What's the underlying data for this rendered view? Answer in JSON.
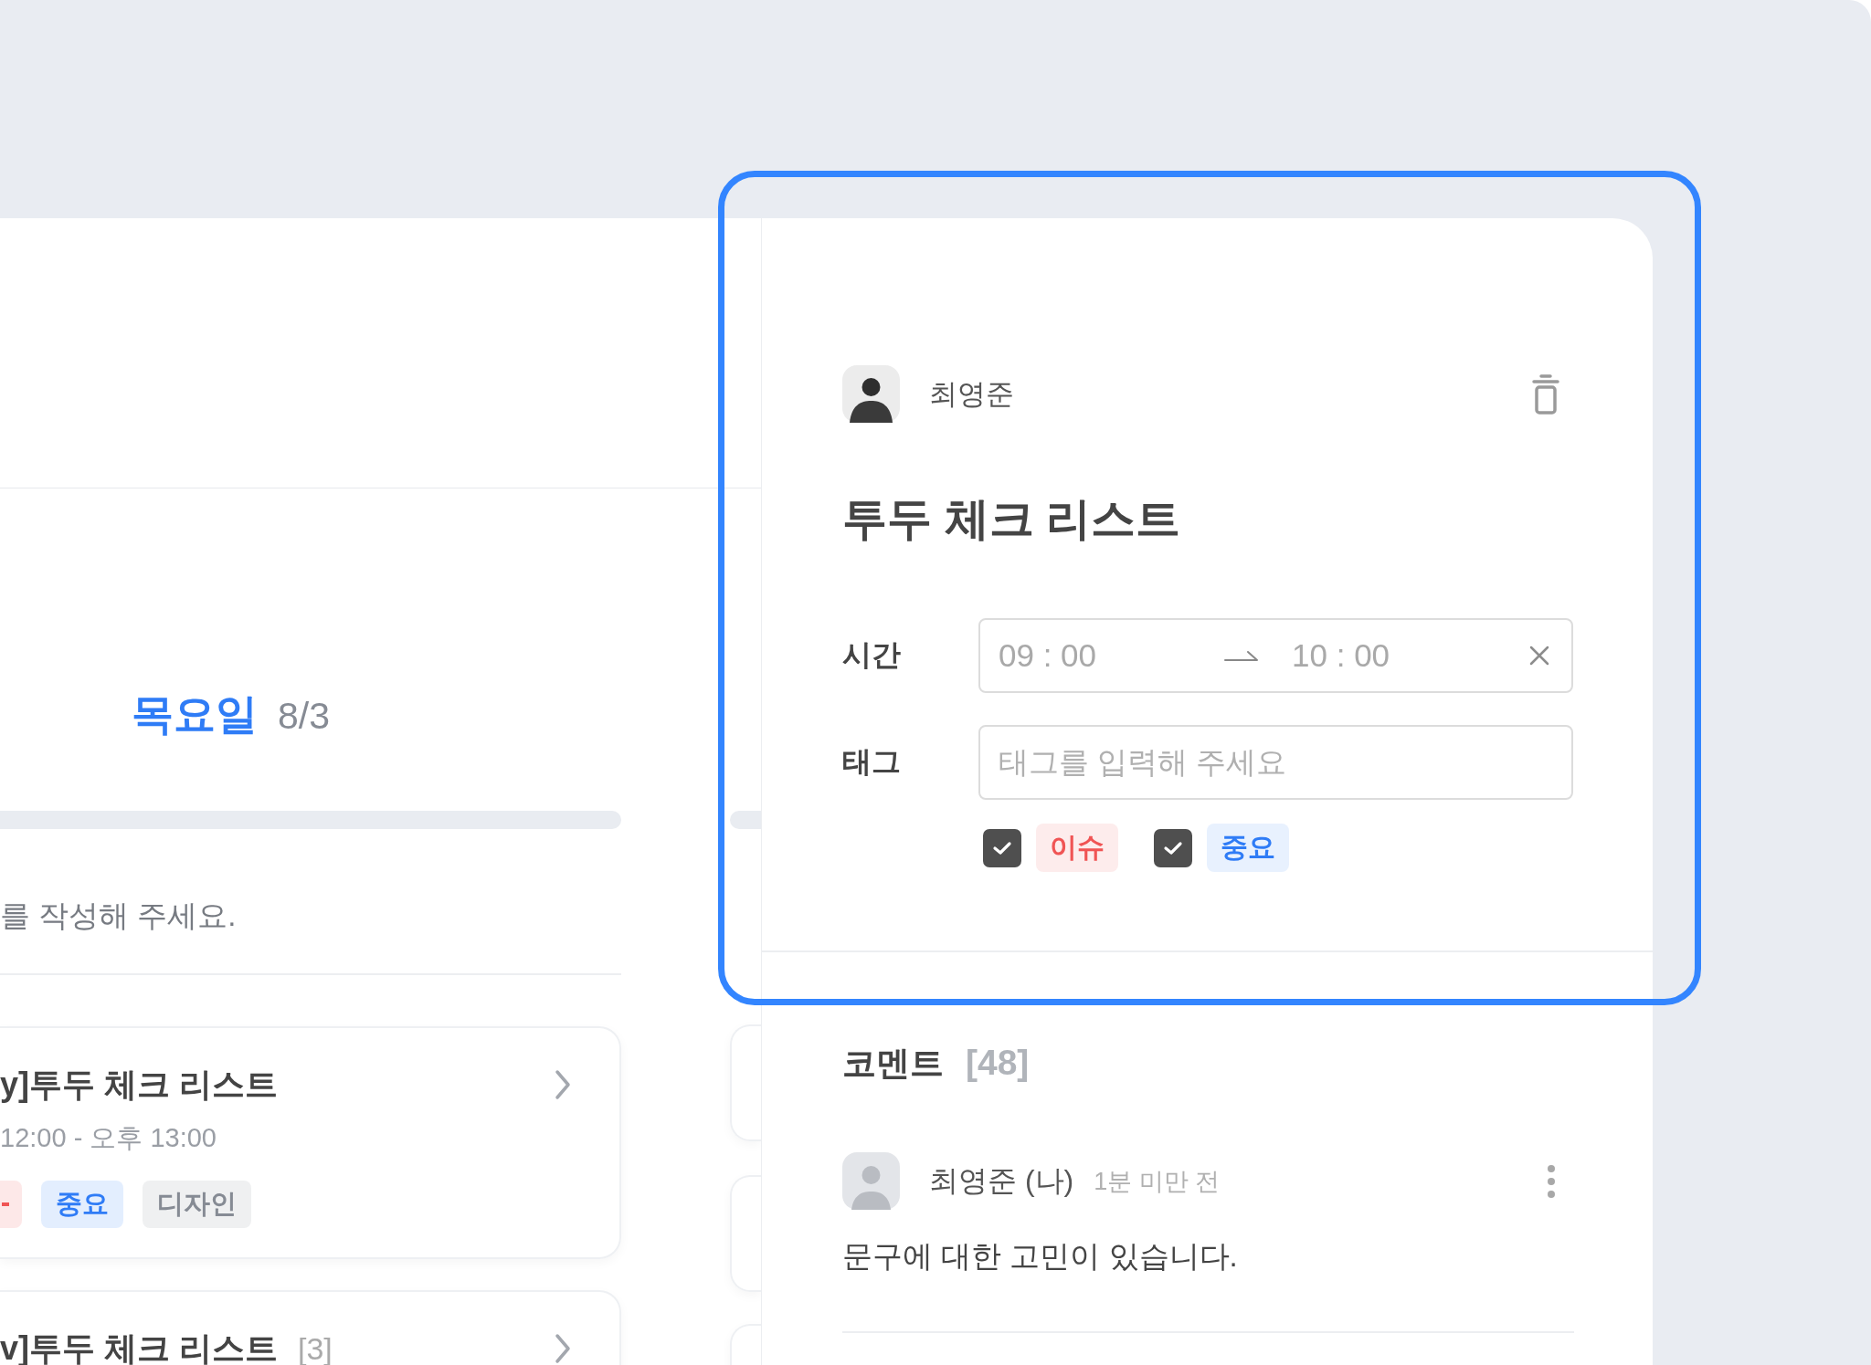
{
  "day_panel": {
    "weekday": "목요일",
    "date": "8/3",
    "note": "를 작성해 주세요.",
    "cards": [
      {
        "title": "y]투두 체크 리스트",
        "time": "12:00 - 오후 13:00",
        "tags": [
          {
            "color": "#f05454"
          },
          {
            "label": "중요",
            "color": "#2f7cf6"
          },
          {
            "label": "디자인",
            "color": "#868b94"
          }
        ]
      },
      {
        "title": "v]투두 체크 리스트",
        "count": "[3]"
      }
    ]
  },
  "detail": {
    "author": "최영준",
    "title": "투두 체크 리스트",
    "fields": [
      {
        "kind": "time",
        "label": "시간",
        "start": "09 : 00",
        "end": "10 : 00"
      },
      {
        "kind": "tags",
        "label": "태그",
        "placeholder": "태그를 입력해 주세요"
      }
    ],
    "tag_options": [
      {
        "label": "이슈",
        "checked": true,
        "color": "#f05454"
      },
      {
        "label": "중요",
        "checked": true,
        "color": "#2f7cf6"
      }
    ]
  },
  "comments": {
    "title": "코멘트",
    "count": "[48]",
    "items": [
      {
        "author": "최영준 (나)",
        "time": "1분 미만 전",
        "text": "문구에 대한 고민이 있습니다."
      }
    ]
  }
}
